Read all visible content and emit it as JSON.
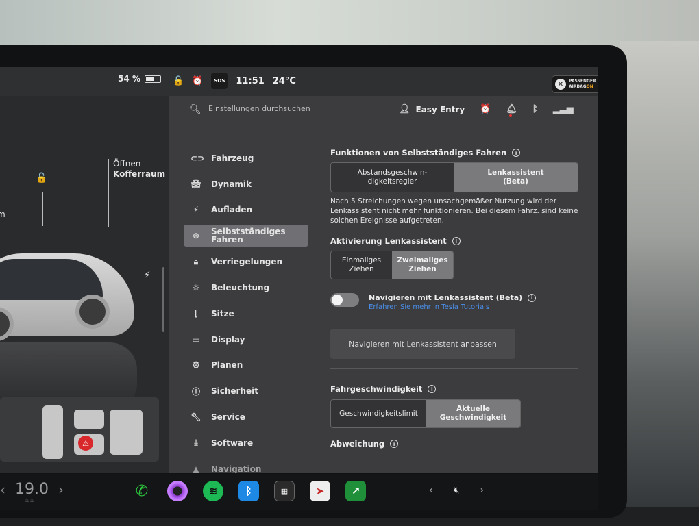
{
  "status": {
    "battery_pct": "54 %",
    "sos": "SOS",
    "time": "11:51",
    "temperature": "24°C",
    "airbag_line1": "PASSENGER",
    "airbag_line2": "AIRBAG",
    "airbag_state": "ON"
  },
  "car": {
    "trunk_line1": "Öffnen",
    "trunk_line2": "Kofferraum",
    "frunk_fragment": "m"
  },
  "search": {
    "placeholder": "Einstellungen durchsuchen"
  },
  "profile": {
    "name": "Easy Entry"
  },
  "nav": {
    "items": [
      {
        "label": "Fahrzeug",
        "icon": "toggle-icon"
      },
      {
        "label": "Dynamik",
        "icon": "car-icon"
      },
      {
        "label": "Aufladen",
        "icon": "bolt-icon"
      },
      {
        "label": "Selbstständiges Fahren",
        "icon": "steering-wheel-icon"
      },
      {
        "label": "Verriegelungen",
        "icon": "lock-icon"
      },
      {
        "label": "Beleuchtung",
        "icon": "light-icon"
      },
      {
        "label": "Sitze",
        "icon": "seat-icon"
      },
      {
        "label": "Display",
        "icon": "display-icon"
      },
      {
        "label": "Planen",
        "icon": "alarm-icon"
      },
      {
        "label": "Sicherheit",
        "icon": "info-icon"
      },
      {
        "label": "Service",
        "icon": "wrench-icon"
      },
      {
        "label": "Software",
        "icon": "download-icon"
      },
      {
        "label": "Navigation",
        "icon": "navigation-icon"
      }
    ]
  },
  "autopilot": {
    "title": "Funktionen von Selbstständiges Fahren",
    "option_a": "Abstandsgeschwin-\ndigkeitsregler",
    "option_b": "Lenkassistent\n(Beta)",
    "description": "Nach 5 Streichungen wegen unsachgemäßer Nutzung wird der Lenkassistent nicht mehr funktionieren. Bei diesem Fahrz. sind keine solchen Ereignisse aufgetreten.",
    "activation_title": "Aktivierung Lenkassistent",
    "activation_a": "Einmaliges\nZiehen",
    "activation_b": "Zweimaliges\nZiehen",
    "nav_toggle_label": "Navigieren mit Lenkassistent (Beta)",
    "nav_toggle_on": false,
    "nav_link": "Erfahren Sie mehr in Tesla Tutorials",
    "customize_button": "Navigieren mit Lenkassistent anpassen",
    "speed_title": "Fahrgeschwindigkeit",
    "speed_a": "Geschwindigkeitslimit",
    "speed_b": "Aktuelle\nGeschwindigkeit",
    "offset_title": "Abweichung"
  },
  "taskbar": {
    "temp": "19.0",
    "apps": [
      "phone-icon",
      "camera-icon",
      "spotify-icon",
      "bluetooth-icon",
      "toybox-icon",
      "navigation-app-icon",
      "stocks-icon"
    ]
  },
  "colors": {
    "accent_orange": "#f1a21d",
    "link_blue": "#4a8ee8",
    "warning_red": "#d8282b"
  }
}
